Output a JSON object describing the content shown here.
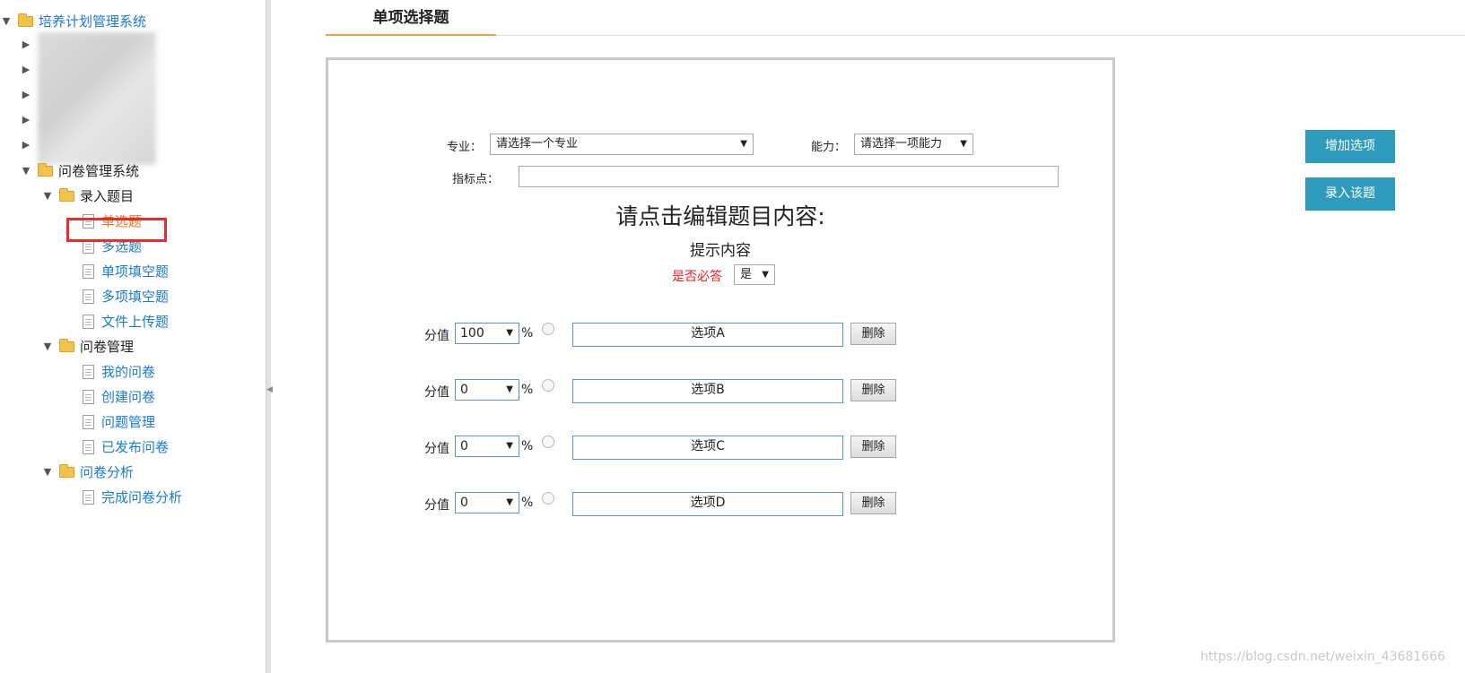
{
  "sidebar": {
    "root": {
      "label": "培养计划管理系统"
    },
    "questionnaire_system": {
      "label": "问卷管理系统"
    },
    "enter_questions": {
      "label": "录入题目",
      "items": [
        "单选题",
        "多选题",
        "单项填空题",
        "多项填空题",
        "文件上传题"
      ]
    },
    "questionnaire_mgmt": {
      "label": "问卷管理",
      "items": [
        "我的问卷",
        "创建问卷",
        "问题管理",
        "已发布问卷"
      ]
    },
    "questionnaire_analysis": {
      "label": "问卷分析",
      "items": [
        "完成问卷分析"
      ]
    },
    "active_item": "单选题"
  },
  "tab": {
    "title": "单项选择题"
  },
  "form": {
    "major_label": "专业：",
    "major_value": "请选择一个专业",
    "ability_label": "能力：",
    "ability_value": "请选择一项能力",
    "indicator_label": "指标点：",
    "indicator_value": "",
    "question_title": "请点击编辑题目内容:",
    "hint": "提示内容",
    "required_label": "是否必答",
    "required_value": "是"
  },
  "options": [
    {
      "score_label": "分值",
      "score": "100",
      "percent": "%",
      "text": "选项A",
      "delete": "删除"
    },
    {
      "score_label": "分值",
      "score": "0",
      "percent": "%",
      "text": "选项B",
      "delete": "删除"
    },
    {
      "score_label": "分值",
      "score": "0",
      "percent": "%",
      "text": "选项C",
      "delete": "删除"
    },
    {
      "score_label": "分值",
      "score": "0",
      "percent": "%",
      "text": "选项D",
      "delete": "删除"
    }
  ],
  "actions": {
    "add_option": "增加选项",
    "submit_question": "录入该题"
  },
  "watermark": "https://blog.csdn.net/weixin_43681666",
  "colors": {
    "link": "#1a7bd0",
    "active": "#ea7a1e",
    "accent_button": "#2e9bbc",
    "required_text": "#ee1d1d",
    "tab_underline": "#f0a04b"
  }
}
